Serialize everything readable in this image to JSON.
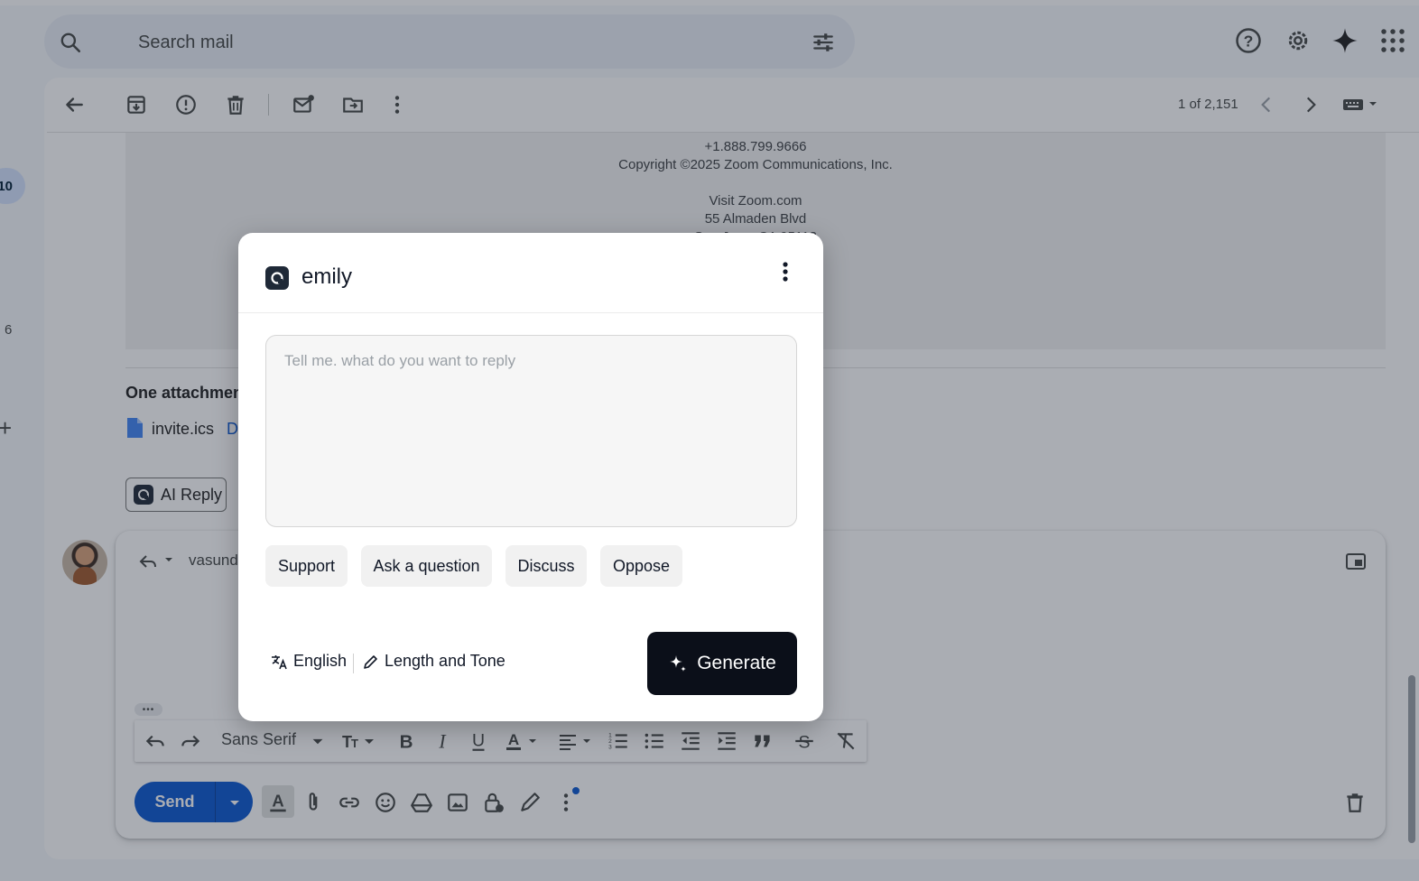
{
  "search": {
    "placeholder": "Search mail"
  },
  "toolbar": {
    "counter": "1 of 2,151"
  },
  "email": {
    "footer_lines": [
      "+1.888.799.9666",
      "Copyright ©2025 Zoom Communications, Inc.",
      "",
      "Visit Zoom.com",
      "55 Almaden Blvd",
      "San Jose, CA 95113"
    ],
    "attachments_title": "One attachment",
    "attachment_name": "invite.ics",
    "attachment_link": "D"
  },
  "ai_reply": {
    "label": "AI Reply"
  },
  "nav": {
    "badge": "10",
    "count": "6",
    "add": "+"
  },
  "compose": {
    "recipient": "vasund",
    "font_family": "Sans Serif",
    "send_label": "Send",
    "more_dots": "•••"
  },
  "modal": {
    "title": "emily",
    "textarea_placeholder": "Tell me. what do you want to reply",
    "chips": [
      "Support",
      "Ask a question",
      "Discuss",
      "Oppose"
    ],
    "language": "English",
    "length_tone": "Length and Tone",
    "generate": "Generate"
  },
  "colors": {
    "primary": "#0b57d0",
    "modal_button": "#0b0f19",
    "scrim": "rgba(32,40,55,0.38)"
  }
}
